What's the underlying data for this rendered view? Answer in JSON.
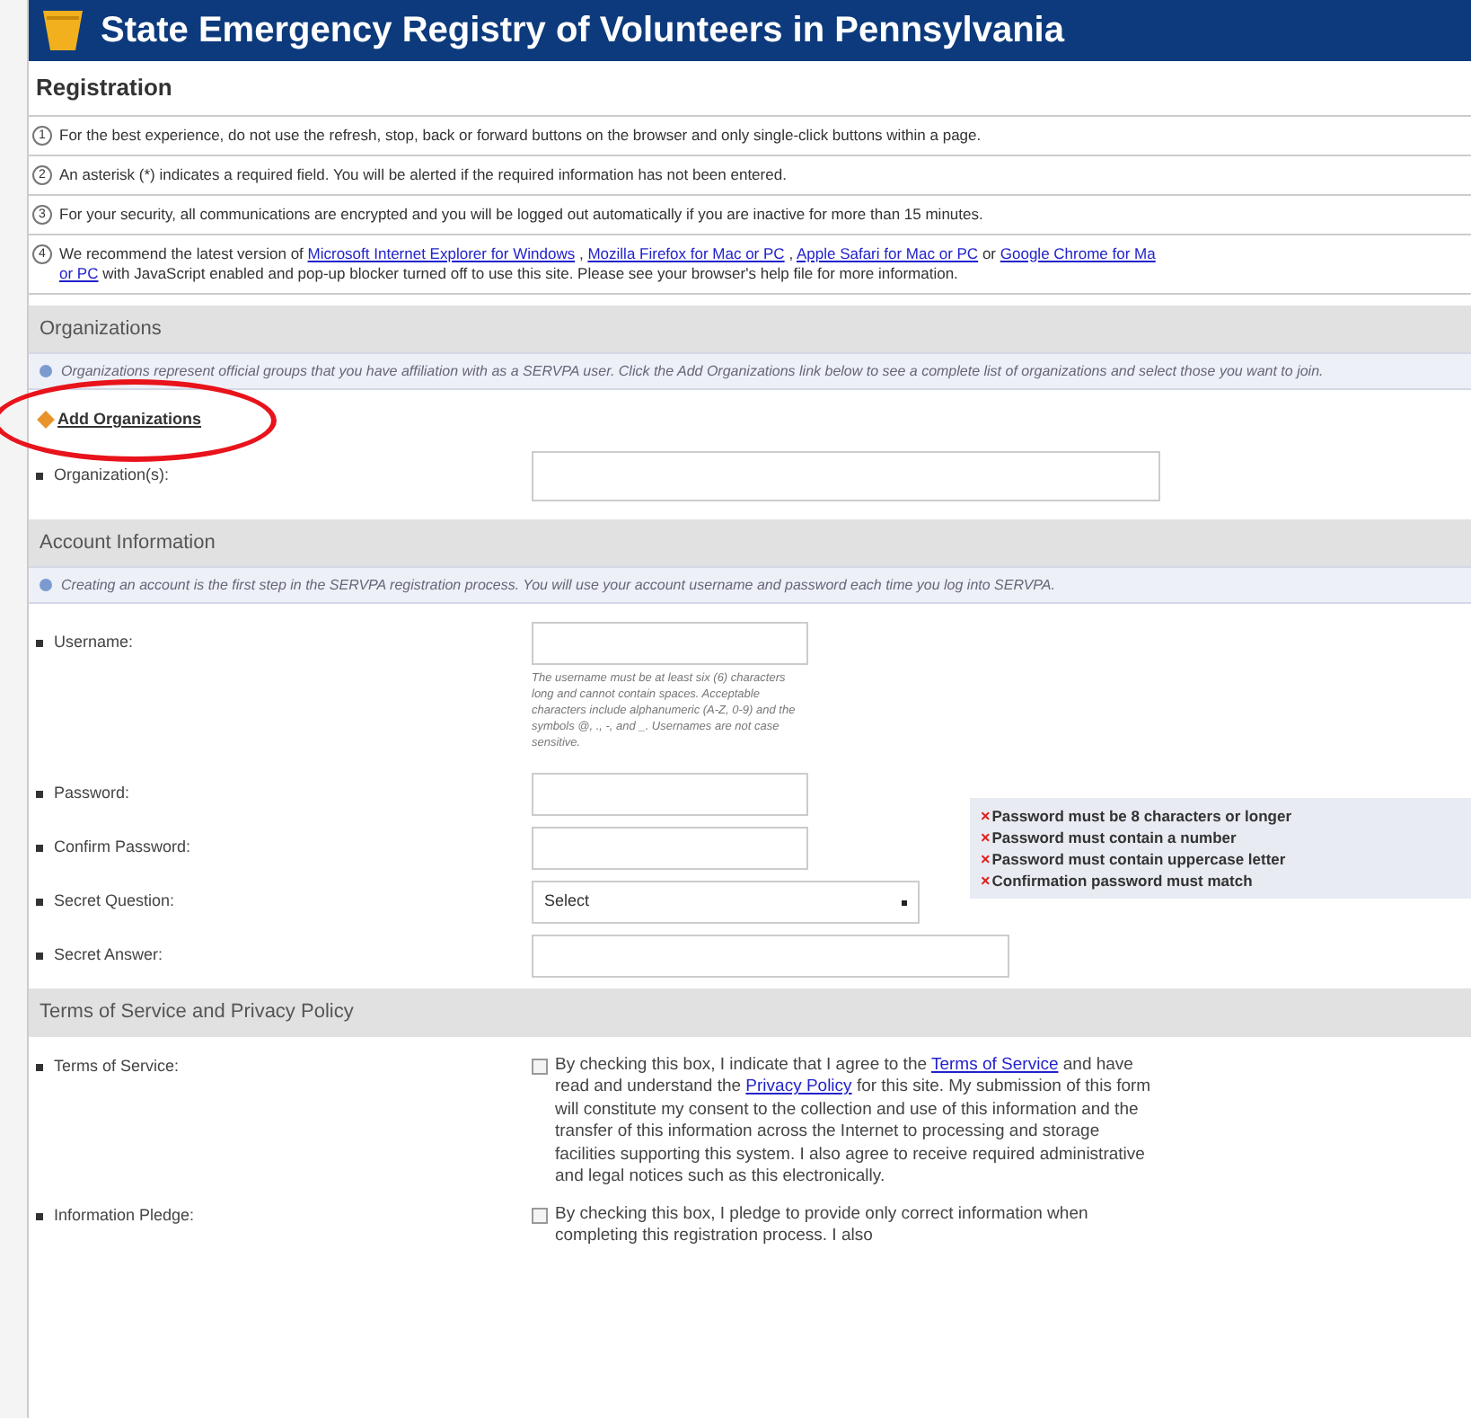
{
  "header": {
    "title": "State Emergency Registry of Volunteers in Pennsylvania"
  },
  "page_title": "Registration",
  "notices": [
    {
      "number": "1",
      "lines": [
        [
          {
            "text": "For the best experience, do not use the refresh, stop, back or forward buttons on the browser and only single-click buttons within a page.",
            "link": false
          }
        ]
      ]
    },
    {
      "number": "2",
      "lines": [
        [
          {
            "text": "An asterisk (*) indicates a required field. You will be alerted if the required information has not been entered.",
            "link": false
          }
        ]
      ]
    },
    {
      "number": "3",
      "lines": [
        [
          {
            "text": "For your security, all communications are encrypted and you will be logged out automatically if you are inactive for more than 15 minutes.",
            "link": false
          }
        ]
      ]
    },
    {
      "number": "4",
      "lines": [
        [
          {
            "text": "We recommend the latest version of",
            "link": false
          },
          {
            "text": "Microsoft Internet Explorer for Windows",
            "link": true
          },
          {
            "text": ",",
            "link": false
          },
          {
            "text": "Mozilla Firefox for Mac or PC",
            "link": true
          },
          {
            "text": ",",
            "link": false
          },
          {
            "text": "Apple Safari for Mac or PC",
            "link": true
          },
          {
            "text": "or",
            "link": false
          },
          {
            "text": "Google Chrome for Ma",
            "link": true
          }
        ],
        [
          {
            "text": "or PC",
            "link": true
          },
          {
            "text": "with JavaScript enabled and pop-up blocker turned off to use this site. Please see your browser's help file for more information.",
            "link": false
          }
        ]
      ]
    }
  ],
  "organizations": {
    "heading": "Organizations",
    "info": "Organizations represent official groups that you have affiliation with as a SERVPA user. Click the Add Organizations link below to see a complete list of organizations and select those you want to join.",
    "add_link": "Add Organizations",
    "field_label": "Organization(s):"
  },
  "account": {
    "heading": "Account Information",
    "info": "Creating an account is the first step in the SERVPA registration process. You will use your account username and password each time you log into SERVPA.",
    "fields": [
      {
        "kind": "text",
        "label": "Username:",
        "help": "The username must be at least six (6) characters long and cannot contain spaces. Acceptable characters include alphanumeric (A-Z, 0-9) and the symbols @, ., -, and _. Usernames are not case sensitive."
      },
      {
        "kind": "text",
        "label": "Password:"
      },
      {
        "kind": "text",
        "label": "Confirm Password:"
      },
      {
        "kind": "select",
        "label": "Secret Question:",
        "value": "Select"
      },
      {
        "kind": "wide",
        "label": "Secret Answer:"
      }
    ],
    "password_rules": [
      {
        "mark": "×",
        "text": "Password must be 8 characters or longer"
      },
      {
        "mark": "×",
        "text": "Password must contain a number"
      },
      {
        "mark": "×",
        "text": "Password must contain uppercase letter"
      },
      {
        "mark": "×",
        "text": "Confirmation password must match"
      }
    ]
  },
  "terms": {
    "heading": "Terms of Service and Privacy Policy",
    "items": [
      {
        "label": "Terms of Service:",
        "checked": false,
        "segments": [
          {
            "text": "By checking this box, I indicate that I agree to the",
            "link": false
          },
          {
            "text": "Terms of Service",
            "link": true
          },
          {
            "text": "and have read and understand the",
            "link": false
          },
          {
            "text": "Privacy Policy",
            "link": true
          },
          {
            "text": "for this site. My submission of this form will constitute my consent to the collection and use of this information and the transfer of this information across the Internet to processing and storage facilities supporting this system. I also agree to receive required administrative and legal notices such as this electronically.",
            "link": false
          }
        ]
      },
      {
        "label": "Information Pledge:",
        "checked": false,
        "segments": [
          {
            "text": "By checking this box, I pledge to provide only correct information when completing this registration process. I also",
            "link": false
          }
        ]
      }
    ]
  }
}
